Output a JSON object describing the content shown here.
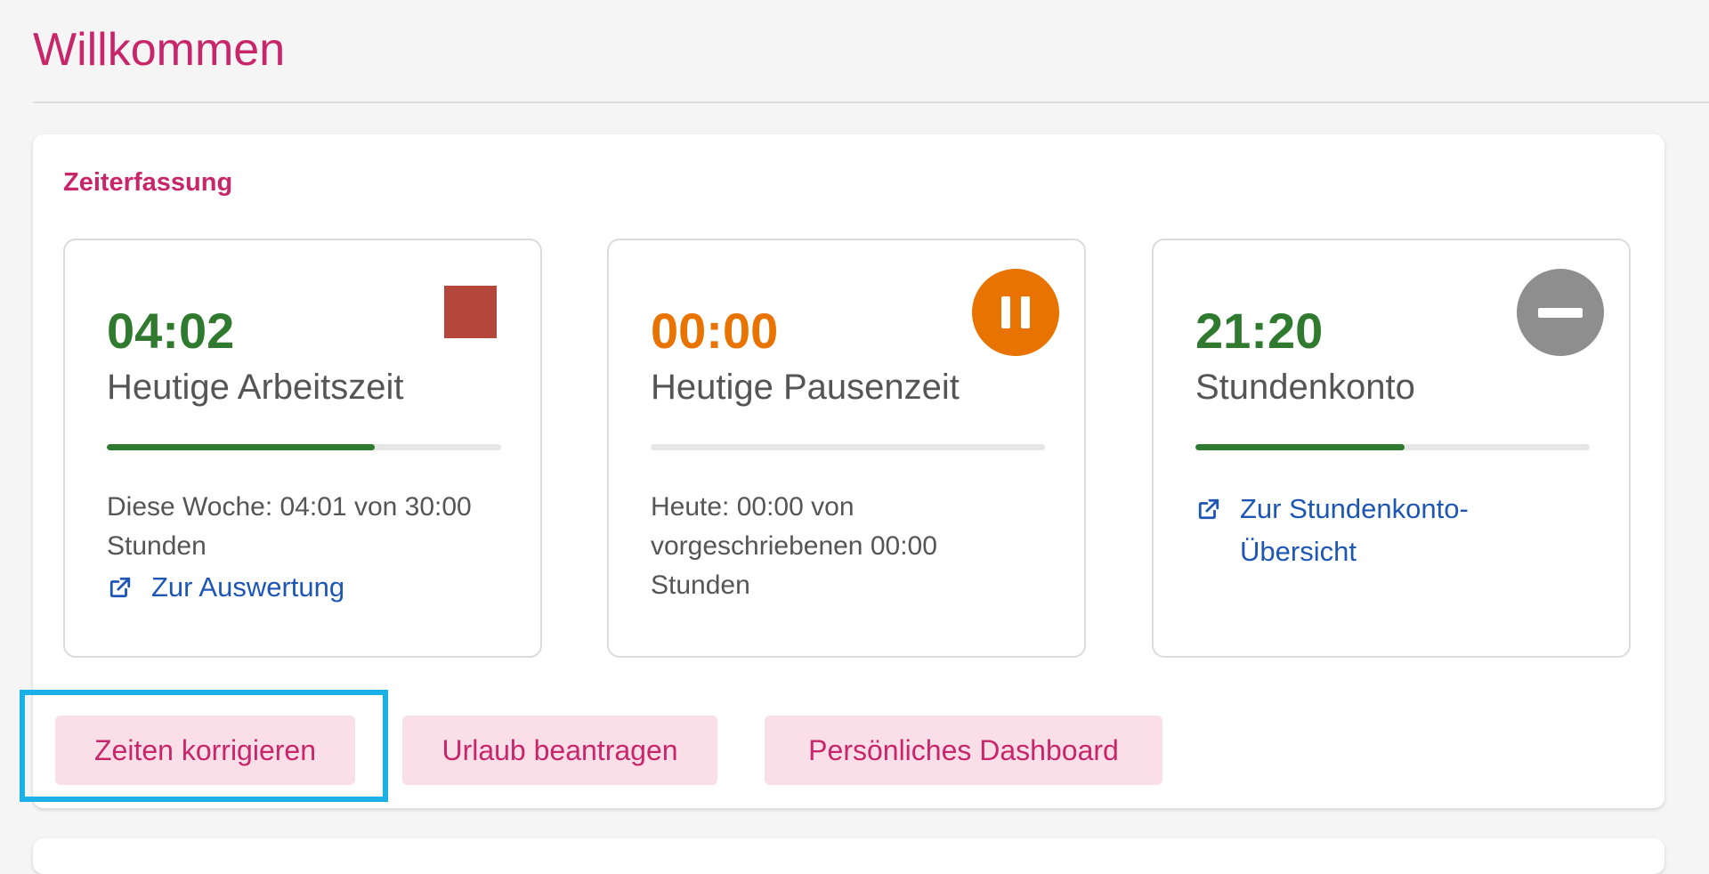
{
  "page": {
    "title": "Willkommen"
  },
  "colors": {
    "brand": "#c8256a",
    "work_green": "#2f7a2f",
    "pause_orange": "#e97300",
    "stop_red": "#b5473a",
    "neutral_grey": "#8e8e8e",
    "link_blue": "#1e56b4",
    "button_bg": "#fbdfe8",
    "focus_blue": "#19b1e6"
  },
  "time_tracking": {
    "heading": "Zeiterfassung",
    "cards": [
      {
        "value": "04:02",
        "label": "Heutige Arbeitszeit",
        "progress_percent": 68,
        "info": "Diese Woche: 04:01 von 30:00 Stunden",
        "link": "Zur Auswertung",
        "action_icon": "stop-icon"
      },
      {
        "value": "00:00",
        "label": "Heutige Pausenzeit",
        "progress_percent": 0,
        "info": "Heute: 00:00 von vorgeschriebenen 00:00 Stunden",
        "action_icon": "pause-icon"
      },
      {
        "value": "21:20",
        "label": "Stundenkonto",
        "progress_percent": 53,
        "link": "Zur Stundenkonto-Übersicht",
        "action_icon": "minus-icon"
      }
    ],
    "actions": {
      "correct_times": "Zeiten korrigieren",
      "request_vacation": "Urlaub beantragen",
      "personal_dashboard": "Persönliches Dashboard"
    }
  }
}
